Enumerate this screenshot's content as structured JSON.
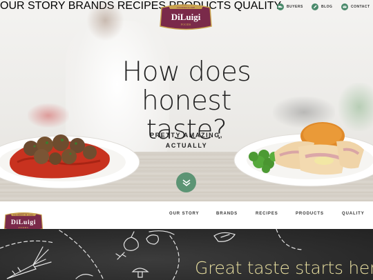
{
  "brand": {
    "name": "DiLuigi",
    "sub": "FOODS",
    "ribbon": "FOUNDED IN 1925",
    "colors": {
      "maroon": "#7a2a4a",
      "gold": "#c9a34e",
      "green": "#5c9474"
    }
  },
  "utility_nav": [
    {
      "label": "BUYERS",
      "icon": "truck-icon"
    },
    {
      "label": "BLOG",
      "icon": "pen-icon"
    },
    {
      "label": "CONTACT",
      "icon": "envelope-icon"
    }
  ],
  "main_nav": [
    "OUR STORY",
    "BRANDS",
    "RECIPES",
    "PRODUCTS",
    "QUALITY"
  ],
  "hero": {
    "headline_line1": "How does honest",
    "headline_line2": "taste?",
    "sub_line1": "PRETTY AMAZING,",
    "sub_line2": "ACTUALLY",
    "scroll_icon": "chevron-down-icon"
  },
  "sticky_nav": [
    "OUR STORY",
    "BRANDS",
    "RECIPES",
    "PRODUCTS",
    "QUALITY"
  ],
  "section": {
    "tagline": "Great taste starts here"
  }
}
